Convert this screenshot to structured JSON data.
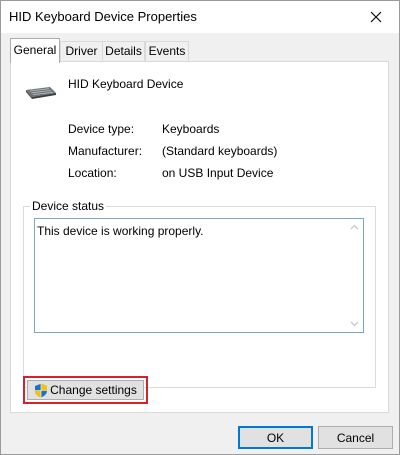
{
  "window": {
    "title": "HID Keyboard Device Properties"
  },
  "tabs": [
    {
      "label": "General",
      "active": true
    },
    {
      "label": "Driver",
      "active": false
    },
    {
      "label": "Details",
      "active": false
    },
    {
      "label": "Events",
      "active": false
    }
  ],
  "device": {
    "name": "HID Keyboard Device",
    "icon": "keyboard-icon",
    "properties": [
      {
        "label": "Device type:",
        "value": "Keyboards"
      },
      {
        "label": "Manufacturer:",
        "value": "(Standard keyboards)"
      },
      {
        "label": "Location:",
        "value": "on USB Input Device"
      }
    ]
  },
  "status": {
    "legend": "Device status",
    "text": "This device is working properly."
  },
  "actions": {
    "change_settings": "Change settings",
    "ok": "OK",
    "cancel": "Cancel"
  },
  "colors": {
    "highlight": "#d6222a",
    "focus": "#0078d7"
  }
}
